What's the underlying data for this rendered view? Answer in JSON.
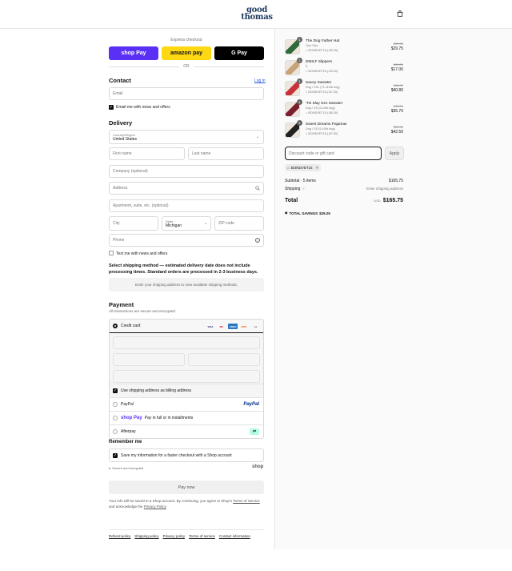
{
  "header": {
    "logo_line1": "good",
    "logo_line2": "thomas",
    "cart_icon": "shopping-bag-icon"
  },
  "express": {
    "label": "Express checkout",
    "shop_pay": "shop Pay",
    "amazon_pay": "amazon pay",
    "google_pay": "G Pay",
    "or": "OR"
  },
  "contact": {
    "heading": "Contact",
    "login_link": "Log in",
    "email_placeholder": "Email",
    "email_news": "Email me with news and offers",
    "email_news_checked": true
  },
  "delivery": {
    "heading": "Delivery",
    "country_label": "Country/Region",
    "country_value": "United States",
    "first_name": "First name",
    "last_name": "Last name",
    "company": "Company (optional)",
    "address": "Address",
    "apartment": "Apartment, suite, etc. (optional)",
    "city": "City",
    "state_label": "State",
    "state_value": "Michigan",
    "zip": "ZIP code",
    "phone": "Phone",
    "text_news": "Text me with news and offers",
    "shipping_method": "Select shipping method — estimated delivery date does not include processing times. Standard orders are processed in 2-3 business days.",
    "shipping_placeholder": "Enter your shipping address to view available shipping methods."
  },
  "payment": {
    "heading": "Payment",
    "subtitle": "All transactions are secure and encrypted.",
    "credit_card": "Credit card",
    "card_brands": [
      "VISA",
      "MC",
      "AMEX",
      "DISC",
      "+4"
    ],
    "billing_same": "Use shipping address as billing address",
    "paypal": "PayPal",
    "paypal_logo": "PayPal",
    "shoppay_logo": "shop Pay",
    "shoppay_desc": "Pay in full or in installments",
    "afterpay": "Afterpay"
  },
  "remember": {
    "heading": "Remember me",
    "save_info": "Save my information for a faster checkout with a Shop account",
    "secure": "Secure and encrypted",
    "shop_logo": "shop"
  },
  "pay_now": "Pay now",
  "disclaimer": {
    "text": "Your info will be saved to a Shop account. By continuing, you agree to Shop's",
    "terms": "Terms of Service",
    "and": "and acknowledge the",
    "privacy": "Privacy Policy"
  },
  "footer": [
    "Refund policy",
    "Shipping policy",
    "Privacy policy",
    "Terms of service",
    "Contact information"
  ],
  "order": {
    "items": [
      {
        "qty": "1",
        "name": "The Dog Father Hat",
        "variant": "One Size",
        "discount": "BONDVET15 (-$5.25)",
        "old_price": "$35.00",
        "price": "$29.75",
        "thumb_color": "#2f6b3a"
      },
      {
        "qty": "1",
        "name": "DMILF Slippers",
        "variant": "S",
        "discount": "BONDVET15 (-$3.00)",
        "old_price": "$20.00",
        "price": "$17.00",
        "thumb_color": "#c9a47a"
      },
      {
        "qty": "1",
        "name": "Saucy Sweater",
        "variant": "Dog / XXL (71-110lb dog)",
        "discount": "BONDVET15 (-$7.20)",
        "old_price": "$48.00",
        "price": "$40.80",
        "thumb_color": "#c8323a"
      },
      {
        "qty": "1",
        "name": "'Tis Slay Szn Sweater",
        "variant": "Dog / XS (5-10lb dog)",
        "discount": "BONDVET15 (-$6.30)",
        "old_price": "$42.00",
        "price": "$35.70",
        "thumb_color": "#7a1f2b"
      },
      {
        "qty": "1",
        "name": "Sweet Dreams Pajamas",
        "variant": "Dog / XS (5-10lb dog)",
        "discount": "BONDVET15 (-$7.50)",
        "old_price": "$50.00",
        "price": "$42.50",
        "thumb_color": "#222222"
      }
    ],
    "discount_placeholder": "Discount code or gift card",
    "apply": "Apply",
    "applied_code": "BONDVET15",
    "subtotal_label": "Subtotal · 5 items",
    "subtotal": "$165.75",
    "shipping_label": "Shipping",
    "shipping_value": "Enter shipping address",
    "total_label": "Total",
    "currency": "USD",
    "total": "$165.75",
    "savings_label": "TOTAL SAVINGS",
    "savings": "$29.25"
  }
}
